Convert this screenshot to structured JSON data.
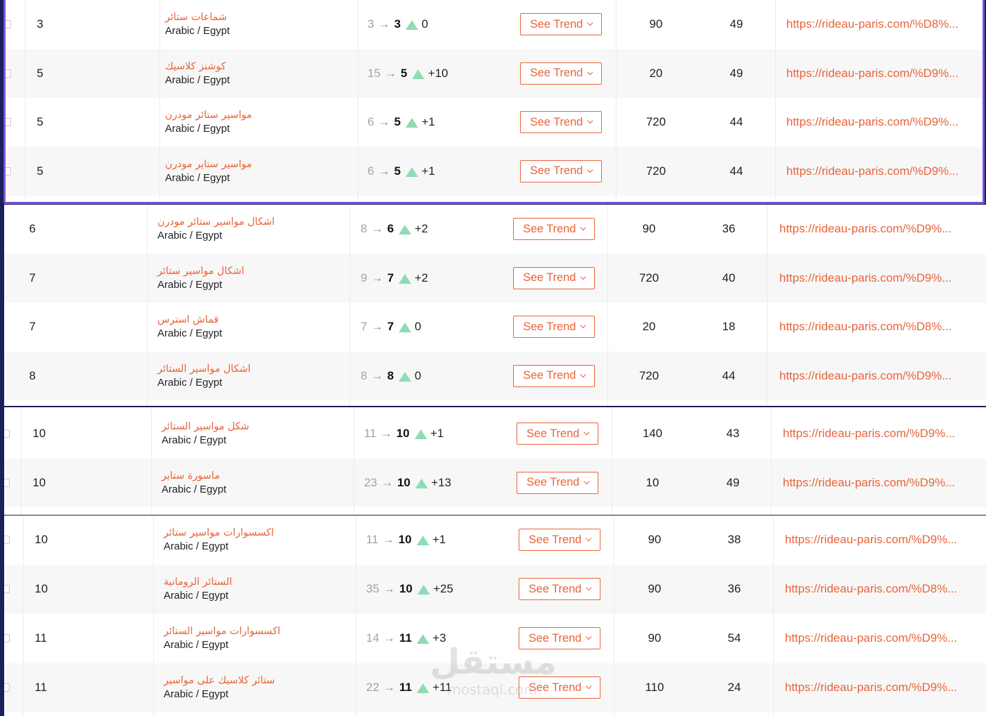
{
  "button_label": "See Trend",
  "watermark": {
    "arabic": "مستقل",
    "latin": "mostaql.com"
  },
  "groups": [
    {
      "rows": [
        {
          "rank": "3",
          "keyword": "شماعات ستائر",
          "location": "Arabic / Egypt",
          "prev": "3",
          "cur": "3",
          "delta": "0",
          "volume": "90",
          "difficulty": "49",
          "url": "https://rideau-paris.com/%D8%..."
        },
        {
          "rank": "5",
          "keyword": "كوشنز كلاسيك",
          "location": "Arabic / Egypt",
          "prev": "15",
          "cur": "5",
          "delta": "+10",
          "volume": "20",
          "difficulty": "49",
          "url": "https://rideau-paris.com/%D9%..."
        },
        {
          "rank": "5",
          "keyword": "مواسير ستائر مودرن",
          "location": "Arabic / Egypt",
          "prev": "6",
          "cur": "5",
          "delta": "+1",
          "volume": "720",
          "difficulty": "44",
          "url": "https://rideau-paris.com/%D9%..."
        },
        {
          "rank": "5",
          "keyword": "مواسير ستاير مودرن",
          "location": "Arabic / Egypt",
          "prev": "6",
          "cur": "5",
          "delta": "+1",
          "volume": "720",
          "difficulty": "44",
          "url": "https://rideau-paris.com/%D9%..."
        }
      ]
    },
    {
      "rows": [
        {
          "rank": "6",
          "keyword": "اشكال مواسير ستائر مودرن",
          "location": "Arabic / Egypt",
          "prev": "8",
          "cur": "6",
          "delta": "+2",
          "volume": "90",
          "difficulty": "36",
          "url": "https://rideau-paris.com/%D9%..."
        },
        {
          "rank": "7",
          "keyword": "اشكال مواسير ستائر",
          "location": "Arabic / Egypt",
          "prev": "9",
          "cur": "7",
          "delta": "+2",
          "volume": "720",
          "difficulty": "40",
          "url": "https://rideau-paris.com/%D9%..."
        },
        {
          "rank": "7",
          "keyword": "قماش استرس",
          "location": "Arabic / Egypt",
          "prev": "7",
          "cur": "7",
          "delta": "0",
          "volume": "20",
          "difficulty": "18",
          "url": "https://rideau-paris.com/%D8%..."
        },
        {
          "rank": "8",
          "keyword": "اشكال مواسير الستائر",
          "location": "Arabic / Egypt",
          "prev": "8",
          "cur": "8",
          "delta": "0",
          "volume": "720",
          "difficulty": "44",
          "url": "https://rideau-paris.com/%D9%..."
        }
      ]
    },
    {
      "rows": [
        {
          "rank": "10",
          "keyword": "شكل مواسير الستائر",
          "location": "Arabic / Egypt",
          "prev": "11",
          "cur": "10",
          "delta": "+1",
          "volume": "140",
          "difficulty": "43",
          "url": "https://rideau-paris.com/%D9%..."
        },
        {
          "rank": "10",
          "keyword": "ماسورة ستاير",
          "location": "Arabic / Egypt",
          "prev": "23",
          "cur": "10",
          "delta": "+13",
          "volume": "10",
          "difficulty": "49",
          "url": "https://rideau-paris.com/%D9%..."
        }
      ]
    },
    {
      "rows": [
        {
          "rank": "10",
          "keyword": "اكسسوارات مواسير ستائر",
          "location": "Arabic / Egypt",
          "prev": "11",
          "cur": "10",
          "delta": "+1",
          "volume": "90",
          "difficulty": "38",
          "url": "https://rideau-paris.com/%D9%..."
        },
        {
          "rank": "10",
          "keyword": "الستائر الرومانية",
          "location": "Arabic / Egypt",
          "prev": "35",
          "cur": "10",
          "delta": "+25",
          "volume": "90",
          "difficulty": "36",
          "url": "https://rideau-paris.com/%D8%..."
        },
        {
          "rank": "11",
          "keyword": "اكسسوارات مواسير الستائر",
          "location": "Arabic / Egypt",
          "prev": "14",
          "cur": "11",
          "delta": "+3",
          "volume": "90",
          "difficulty": "54",
          "url": "https://rideau-paris.com/%D9%..."
        },
        {
          "rank": "11",
          "keyword": "ستائر كلاسيك على مواسير",
          "location": "Arabic / Egypt",
          "prev": "22",
          "cur": "11",
          "delta": "+11",
          "volume": "110",
          "difficulty": "24",
          "url": "https://rideau-paris.com/%D9%..."
        }
      ]
    }
  ]
}
